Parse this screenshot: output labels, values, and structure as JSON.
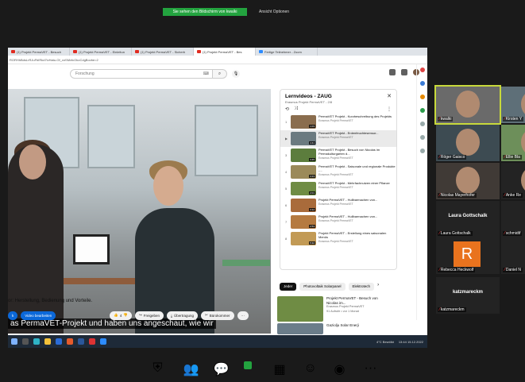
{
  "zoom": {
    "share_banner": "Sie sehen den Bildschirm von kwalki",
    "view_options": "Ansicht Optionen"
  },
  "browser": {
    "tabs": [
      "(1) Projekt PermaVET - Besuch",
      "(1) Projekt PermaVET - Einleitun",
      "(1) Projekt PermaVET - Sicherh",
      "(1) Projekt PermaVET - Bes",
      "Fertige Teilnehmer - Zoom"
    ],
    "url": "RORHhBdsLrRJuFbIRkd7ivHatu-Of_xnSMvfcOkoCdgBovbe=2"
  },
  "youtube": {
    "search_placeholder": "Forschung",
    "subtitle": "as PermaVET-Projekt und haben uns angeschaut, wie wir",
    "description": "or: Herstellung, Bedienung und Vorteile.",
    "subscribe_label": "k",
    "edit_label": "Video bearbeiten",
    "like_count": "4",
    "share_label": "Freigeben",
    "download_label": "Übertragung",
    "clip_label": "Bürokommer",
    "more_label": "···"
  },
  "playlist": {
    "title": "Lernvideos - ZAUG",
    "subtitle": "Erasmus Projekt PermaVET - 2/8",
    "items": [
      {
        "num": "1",
        "title": "PermaVET Projekt - Kurzbeschreibung des Projekts",
        "channel": "Erasmus Projekt PermaVET",
        "duration": "1:03",
        "color": "#8a6d4e"
      },
      {
        "num": "▶",
        "title": "PermaVET Projekt - Erdenfeuchtesensor...",
        "channel": "Erasmus Projekt PermaVET",
        "duration": "4:41",
        "color": "#6b7a80"
      },
      {
        "num": "3",
        "title": "PermaVET Projekt - Besuch von Nicolas im Permakulturgarten d...",
        "channel": "Erasmus Projekt PermaVET",
        "duration": "3:45",
        "color": "#5c7d3d"
      },
      {
        "num": "4",
        "title": "PermaVET Projekt - Saisonale und regionale Produkte -...",
        "channel": "Erasmus Projekt PermaVET",
        "duration": "4:13",
        "color": "#9b8a5a"
      },
      {
        "num": "5",
        "title": "PermaVET Projekt - Mehrfachnutzen einer Pflanze",
        "channel": "Erasmus Projekt PermaVET",
        "duration": "2:01",
        "color": "#6f8c44"
      },
      {
        "num": "6",
        "title": "Projekt PermaVET - Hullbarmachen von...",
        "channel": "Erasmus Projekt PermaVET",
        "duration": "3:12",
        "color": "#a96b3b"
      },
      {
        "num": "7",
        "title": "Projekt PermaVET - Hullbarmachen von...",
        "channel": "Erasmus Projekt PermaVET",
        "duration": "2:53",
        "color": "#b57a40"
      },
      {
        "num": "8",
        "title": "Projekt PermaVET - Erstellung eines saisonalen Menüs",
        "channel": "Erasmus Projekt PermaVET",
        "duration": "5:32",
        "color": "#c29a55"
      }
    ]
  },
  "chips": [
    "Jeder",
    "Photovoltaik Solarpanel",
    "Elektrotech"
  ],
  "recommended": [
    {
      "title": "Projekt PermaVET - Besuch von Nicolas im...",
      "channel": "Erasmus Projekt PermaVET",
      "meta": "91 Aufrufe • vor 1 Monat",
      "color": "#6f8c44"
    },
    {
      "title": "Gaziolju Solar Enerji",
      "channel": "",
      "meta": "",
      "color": "#6b7d8a"
    }
  ],
  "taskbar": {
    "weather": "4°C Bewölkt",
    "time": "13:44",
    "date": "15.12.2022"
  },
  "participants": [
    {
      "name": "kwalki",
      "bg": "#6a6a6a",
      "big": ""
    },
    {
      "name": "Kirsten Y",
      "bg": "#5e6f78",
      "big": ""
    },
    {
      "name": "Röger Gaisco",
      "bg": "#3d4b52",
      "big": ""
    },
    {
      "name": "Ellie Bla",
      "bg": "#6d8f5a",
      "big": ""
    },
    {
      "name": "Nicolas Mayerhofer",
      "bg": "#403a36",
      "big": ""
    },
    {
      "name": "Anke Re",
      "bg": "#232323",
      "big": ""
    },
    {
      "name": "Laura Gottschalk",
      "bg": "#232323",
      "big": "Laura Gottschalk"
    },
    {
      "name": "schmidtf",
      "bg": "#232323",
      "big": "sc"
    },
    {
      "name": "Rebecca Heckwolf",
      "bg": "#232323",
      "big": "R"
    },
    {
      "name": "Daniel N",
      "bg": "#232323",
      "big": "Dan"
    },
    {
      "name": "katzmareckm",
      "bg": "#232323",
      "big": "katzmareckm"
    }
  ]
}
